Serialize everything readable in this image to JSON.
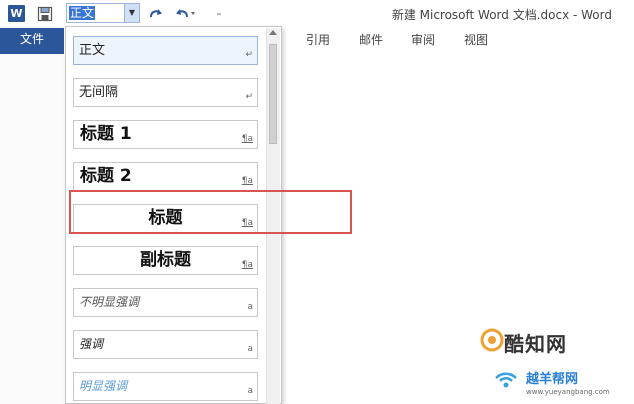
{
  "titlebar": {
    "app_icon_letter": "W",
    "style_combo_value": "正文",
    "window_title": "新建 Microsoft Word 文档.docx - Word"
  },
  "ribbon": {
    "file_tab": "文件",
    "tabs": [
      "引用",
      "邮件",
      "审阅",
      "视图"
    ]
  },
  "style_gallery": {
    "items": [
      {
        "label": "正文",
        "mark": "↵"
      },
      {
        "label": "无间隔",
        "mark": "↵"
      },
      {
        "label": "标题 1",
        "mark": "¶a"
      },
      {
        "label": "标题 2",
        "mark": "¶a"
      },
      {
        "label": "标题",
        "mark": "¶a"
      },
      {
        "label": "副标题",
        "mark": "¶a"
      },
      {
        "label": "不明显强调",
        "mark": "a"
      },
      {
        "label": "强调",
        "mark": "a"
      },
      {
        "label": "明显强调",
        "mark": "a"
      }
    ]
  },
  "watermark": {
    "brand": "酷知网",
    "site": "越羊帮网",
    "url": "www.yueyangbang.com"
  },
  "colors": {
    "word_blue": "#2b579a",
    "highlight_red": "#d9534f",
    "selection_blue": "#3875d7"
  }
}
